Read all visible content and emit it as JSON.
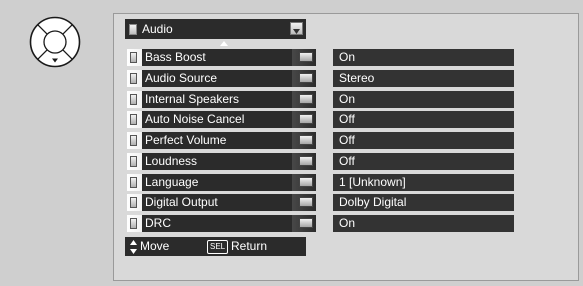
{
  "menu": {
    "title": "Audio",
    "items": [
      {
        "label": "Bass Boost",
        "value": "On"
      },
      {
        "label": "Audio Source",
        "value": "Stereo"
      },
      {
        "label": "Internal Speakers",
        "value": "On"
      },
      {
        "label": "Auto Noise Cancel",
        "value": "Off"
      },
      {
        "label": "Perfect Volume",
        "value": "Off"
      },
      {
        "label": "Loudness",
        "value": "Off"
      },
      {
        "label": "Language",
        "value": "1 [Unknown]"
      },
      {
        "label": "Digital Output",
        "value": "Dolby Digital"
      },
      {
        "label": "DRC",
        "value": "On"
      }
    ]
  },
  "help": {
    "move_label": "Move",
    "sel_key": "SEL",
    "return_label": "Return"
  },
  "icons": {
    "dpad": "remote-dpad-icon",
    "scroll_up": "scroll-up-arrow-icon",
    "updown": "up-down-arrow-icon"
  }
}
